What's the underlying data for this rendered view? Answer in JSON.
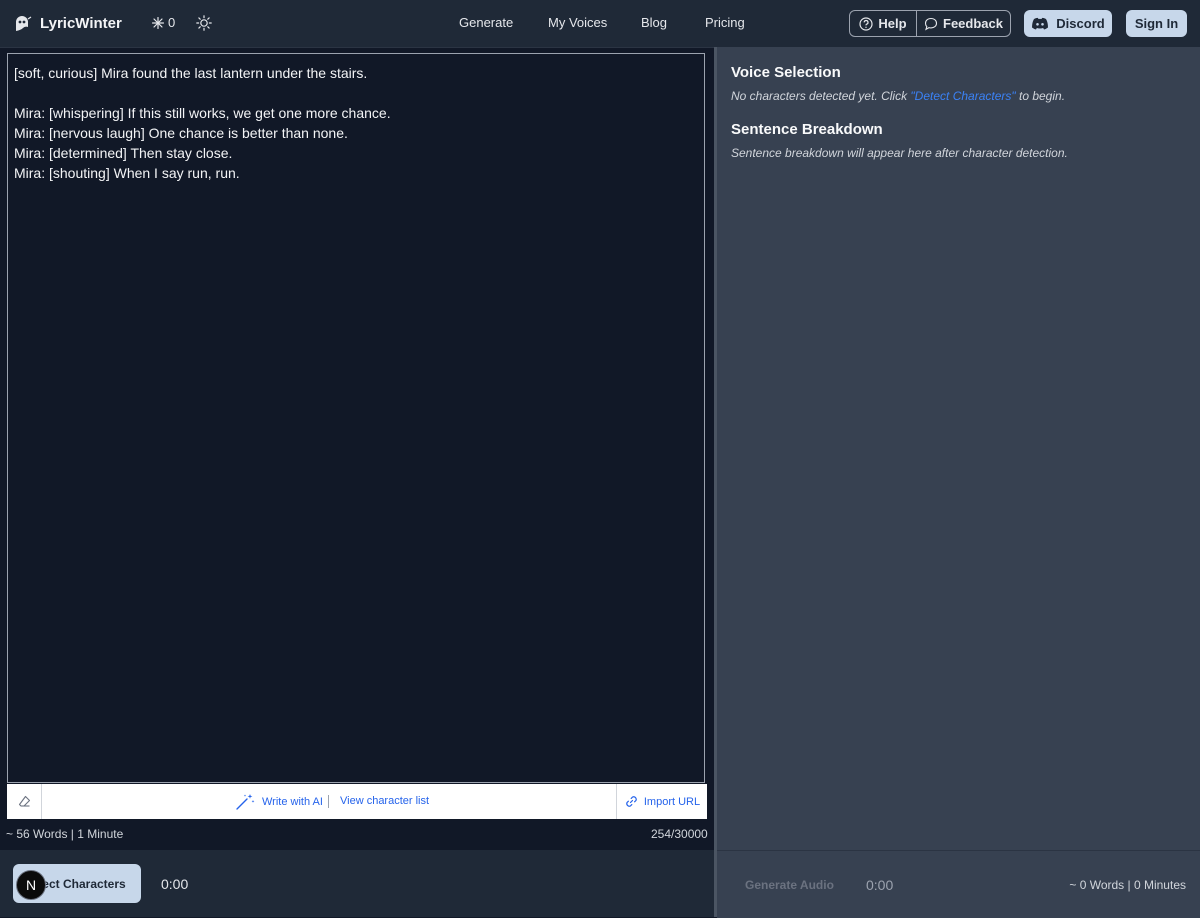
{
  "header": {
    "brand": "LyricWinter",
    "credits": "0",
    "nav": [
      "Generate",
      "My Voices",
      "Blog",
      "Pricing"
    ],
    "help_label": "Help",
    "feedback_label": "Feedback",
    "discord_label": "Discord",
    "signin_label": "Sign In"
  },
  "editor": {
    "lines": [
      "[soft, curious] Mira found the last lantern under the stairs.",
      "",
      "Mira: [whispering] If this still works, we get one more chance.",
      "Mira: [nervous laugh] One chance is better than none.",
      "Mira: [determined] Then stay close.",
      "Mira: [shouting] When I say run, run."
    ],
    "toolbar": {
      "write_ai": "Write with AI",
      "view_chars": "View character list",
      "import_url": "Import URL"
    },
    "stats": "~ 56 Words | 1 Minute",
    "char_count": "254/30000"
  },
  "bottom_left": {
    "detect_label": "ect Characters",
    "avatar_letter": "N",
    "time": "0:00"
  },
  "right": {
    "voice_title": "Voice Selection",
    "voice_msg_before": "No characters detected yet. Click ",
    "voice_msg_link": "\"Detect Characters\"",
    "voice_msg_after": " to begin.",
    "breakdown_title": "Sentence Breakdown",
    "breakdown_msg": "Sentence breakdown will appear here after character detection."
  },
  "bottom_right": {
    "generate_label": "Generate Audio",
    "time": "0:00",
    "stats": "~ 0 Words | 0 Minutes"
  },
  "icons": [
    "ghost-logo-icon",
    "snowflake-icon",
    "sun-icon",
    "help-circle-icon",
    "chat-bubble-icon",
    "discord-icon",
    "eraser-icon",
    "magic-wand-icon",
    "link-icon"
  ],
  "colors": {
    "accent": "#c7d7ea",
    "link": "#3b82f6",
    "background": "#111827",
    "panel": "#374151"
  }
}
